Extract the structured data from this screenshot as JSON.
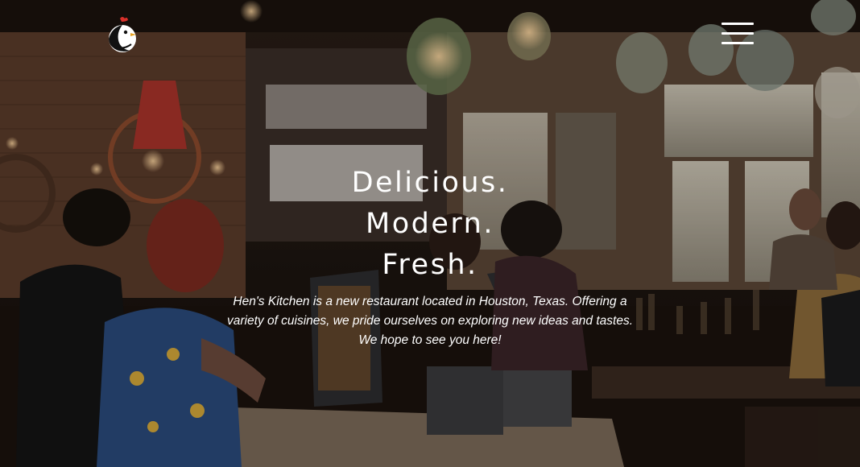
{
  "brand": {
    "logo_icon": "hen-logo-icon",
    "accent": "#d8302a"
  },
  "nav": {
    "menu_icon": "hamburger-menu-icon"
  },
  "hero": {
    "headline_lines": [
      "Delicious.",
      "Modern.",
      "Fresh."
    ],
    "intro_lines": [
      "Hen's Kitchen is a new restaurant located in Houston, Texas. Offering a",
      "variety of cuisines, we pride ourselves on exploring new ideas and tastes.",
      "We hope to see you here!"
    ],
    "background_image": "restaurant-interior-photo"
  }
}
